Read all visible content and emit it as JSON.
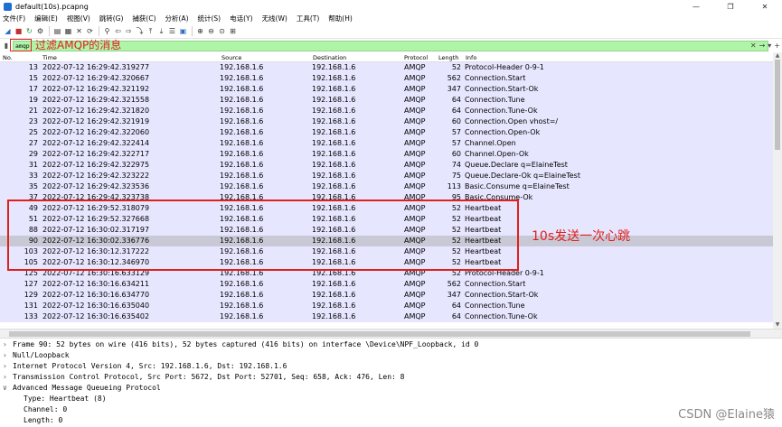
{
  "window": {
    "title": "default(10s).pcapng",
    "minimize": "—",
    "maximize": "❐",
    "close": "✕"
  },
  "menu": [
    "文件(F)",
    "编辑(E)",
    "视图(V)",
    "跳转(G)",
    "捕获(C)",
    "分析(A)",
    "统计(S)",
    "电话(Y)",
    "无线(W)",
    "工具(T)",
    "帮助(H)"
  ],
  "filter": {
    "value": "amqp",
    "annotation": "过滤AMQP的消息"
  },
  "columns": {
    "no": "No.",
    "time": "Time",
    "source": "Source",
    "destination": "Destination",
    "protocol": "Protocol",
    "length": "Length",
    "info": "Info"
  },
  "packets": [
    {
      "no": "13",
      "time": "2022-07-12 16:29:42.319277",
      "src": "192.168.1.6",
      "dst": "192.168.1.6",
      "proto": "AMQP",
      "len": "52",
      "info": "Protocol-Header 0-9-1"
    },
    {
      "no": "15",
      "time": "2022-07-12 16:29:42.320667",
      "src": "192.168.1.6",
      "dst": "192.168.1.6",
      "proto": "AMQP",
      "len": "562",
      "info": "Connection.Start"
    },
    {
      "no": "17",
      "time": "2022-07-12 16:29:42.321192",
      "src": "192.168.1.6",
      "dst": "192.168.1.6",
      "proto": "AMQP",
      "len": "347",
      "info": "Connection.Start-Ok"
    },
    {
      "no": "19",
      "time": "2022-07-12 16:29:42.321558",
      "src": "192.168.1.6",
      "dst": "192.168.1.6",
      "proto": "AMQP",
      "len": "64",
      "info": "Connection.Tune"
    },
    {
      "no": "21",
      "time": "2022-07-12 16:29:42.321820",
      "src": "192.168.1.6",
      "dst": "192.168.1.6",
      "proto": "AMQP",
      "len": "64",
      "info": "Connection.Tune-Ok"
    },
    {
      "no": "23",
      "time": "2022-07-12 16:29:42.321919",
      "src": "192.168.1.6",
      "dst": "192.168.1.6",
      "proto": "AMQP",
      "len": "60",
      "info": "Connection.Open vhost=/"
    },
    {
      "no": "25",
      "time": "2022-07-12 16:29:42.322060",
      "src": "192.168.1.6",
      "dst": "192.168.1.6",
      "proto": "AMQP",
      "len": "57",
      "info": "Connection.Open-Ok"
    },
    {
      "no": "27",
      "time": "2022-07-12 16:29:42.322414",
      "src": "192.168.1.6",
      "dst": "192.168.1.6",
      "proto": "AMQP",
      "len": "57",
      "info": "Channel.Open"
    },
    {
      "no": "29",
      "time": "2022-07-12 16:29:42.322717",
      "src": "192.168.1.6",
      "dst": "192.168.1.6",
      "proto": "AMQP",
      "len": "60",
      "info": "Channel.Open-Ok"
    },
    {
      "no": "31",
      "time": "2022-07-12 16:29:42.322975",
      "src": "192.168.1.6",
      "dst": "192.168.1.6",
      "proto": "AMQP",
      "len": "74",
      "info": "Queue.Declare q=ElaineTest"
    },
    {
      "no": "33",
      "time": "2022-07-12 16:29:42.323222",
      "src": "192.168.1.6",
      "dst": "192.168.1.6",
      "proto": "AMQP",
      "len": "75",
      "info": "Queue.Declare-Ok q=ElaineTest"
    },
    {
      "no": "35",
      "time": "2022-07-12 16:29:42.323536",
      "src": "192.168.1.6",
      "dst": "192.168.1.6",
      "proto": "AMQP",
      "len": "113",
      "info": "Basic.Consume q=ElaineTest"
    },
    {
      "no": "37",
      "time": "2022-07-12 16:29:42.323738",
      "src": "192.168.1.6",
      "dst": "192.168.1.6",
      "proto": "AMQP",
      "len": "95",
      "info": "Basic.Consume-Ok"
    },
    {
      "no": "49",
      "time": "2022-07-12 16:29:52.318079",
      "src": "192.168.1.6",
      "dst": "192.168.1.6",
      "proto": "AMQP",
      "len": "52",
      "info": "Heartbeat"
    },
    {
      "no": "51",
      "time": "2022-07-12 16:29:52.327668",
      "src": "192.168.1.6",
      "dst": "192.168.1.6",
      "proto": "AMQP",
      "len": "52",
      "info": "Heartbeat"
    },
    {
      "no": "88",
      "time": "2022-07-12 16:30:02.317197",
      "src": "192.168.1.6",
      "dst": "192.168.1.6",
      "proto": "AMQP",
      "len": "52",
      "info": "Heartbeat"
    },
    {
      "no": "90",
      "time": "2022-07-12 16:30:02.336776",
      "src": "192.168.1.6",
      "dst": "192.168.1.6",
      "proto": "AMQP",
      "len": "52",
      "info": "Heartbeat",
      "selected": true
    },
    {
      "no": "103",
      "time": "2022-07-12 16:30:12.317222",
      "src": "192.168.1.6",
      "dst": "192.168.1.6",
      "proto": "AMQP",
      "len": "52",
      "info": "Heartbeat"
    },
    {
      "no": "105",
      "time": "2022-07-12 16:30:12.346970",
      "src": "192.168.1.6",
      "dst": "192.168.1.6",
      "proto": "AMQP",
      "len": "52",
      "info": "Heartbeat"
    },
    {
      "no": "125",
      "time": "2022-07-12 16:30:16.633129",
      "src": "192.168.1.6",
      "dst": "192.168.1.6",
      "proto": "AMQP",
      "len": "52",
      "info": "Protocol-Header 0-9-1"
    },
    {
      "no": "127",
      "time": "2022-07-12 16:30:16.634211",
      "src": "192.168.1.6",
      "dst": "192.168.1.6",
      "proto": "AMQP",
      "len": "562",
      "info": "Connection.Start"
    },
    {
      "no": "129",
      "time": "2022-07-12 16:30:16.634770",
      "src": "192.168.1.6",
      "dst": "192.168.1.6",
      "proto": "AMQP",
      "len": "347",
      "info": "Connection.Start-Ok"
    },
    {
      "no": "131",
      "time": "2022-07-12 16:30:16.635040",
      "src": "192.168.1.6",
      "dst": "192.168.1.6",
      "proto": "AMQP",
      "len": "64",
      "info": "Connection.Tune"
    },
    {
      "no": "133",
      "time": "2022-07-12 16:30:16.635402",
      "src": "192.168.1.6",
      "dst": "192.168.1.6",
      "proto": "AMQP",
      "len": "64",
      "info": "Connection.Tune-Ok"
    }
  ],
  "heartbeat_annotation": "10s发送一次心跳",
  "details": [
    {
      "text": "Frame 90: 52 bytes on wire (416 bits), 52 bytes captured (416 bits) on interface \\Device\\NPF_Loopback, id 0",
      "expanded": false
    },
    {
      "text": "Null/Loopback",
      "expanded": false
    },
    {
      "text": "Internet Protocol Version 4, Src: 192.168.1.6, Dst: 192.168.1.6",
      "expanded": false
    },
    {
      "text": "Transmission Control Protocol, Src Port: 5672, Dst Port: 52701, Seq: 658, Ack: 476, Len: 8",
      "expanded": false
    },
    {
      "text": "Advanced Message Queueing Protocol",
      "expanded": true
    },
    {
      "text": "Type: Heartbeat (8)",
      "child": true
    },
    {
      "text": "Channel: 0",
      "child": true
    },
    {
      "text": "Length: 0",
      "child": true
    }
  ],
  "watermark": "CSDN @Elaine猿",
  "colors": {
    "row_bg": "#e7e6ff",
    "row_selected": "#c9c9d6",
    "filter_bg": "#aff5a8",
    "annotation_red": "#e0201b"
  }
}
